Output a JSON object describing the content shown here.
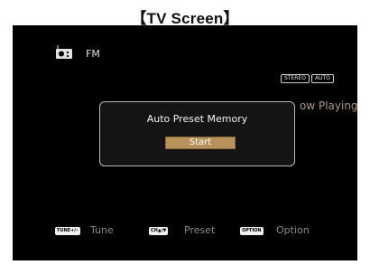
{
  "heading": "【TV Screen】",
  "source": {
    "icon": "radio-icon",
    "label": "FM"
  },
  "badges": [
    "STEREO",
    "AUTO"
  ],
  "now_playing": "ow Playing",
  "dialog": {
    "title": "Auto Preset Memory",
    "button_label": "Start"
  },
  "hints": [
    {
      "key": "TUNE+/–",
      "label": "Tune"
    },
    {
      "key": "CH▲/▼",
      "label": "Preset"
    },
    {
      "key": "OPTION",
      "label": "Option"
    }
  ],
  "colors": {
    "screen_bg": "#000000",
    "button_bg": "#b9925b",
    "dim_text": "#8a8a8a",
    "now_playing_text": "#a89a86"
  }
}
